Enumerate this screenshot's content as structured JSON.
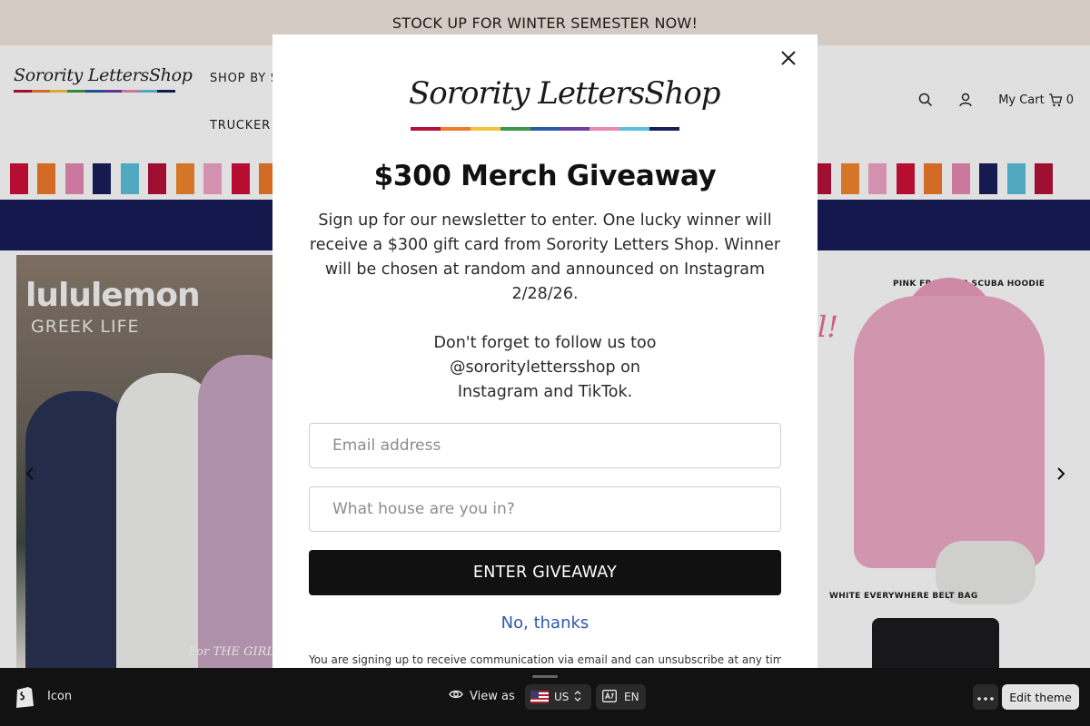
{
  "announcement": {
    "text": "STOCK UP FOR WINTER SEMESTER NOW!"
  },
  "header": {
    "logo_text": "Sorority LettersShop",
    "nav": [
      {
        "label": "SHOP BY SO"
      },
      {
        "label": "TRUCKER H"
      }
    ],
    "cart_label": "My Cart",
    "cart_count": "0",
    "search_icon": "search-icon",
    "account_icon": "user-icon",
    "cart_icon": "cart-icon"
  },
  "stripe_colors": [
    "#d0103a",
    "#f07a2a",
    "#e889b4",
    "#1a1f5a",
    "#5cc0dc",
    "#b5123a",
    "#f3862e",
    "#f2a6c8"
  ],
  "brand_colors": [
    "#b5123a",
    "#f07a2a",
    "#f2c53d",
    "#3a9a4a",
    "#2a5aa8",
    "#6b3fa0",
    "#e889b4",
    "#5cc0dc",
    "#1a1f5a"
  ],
  "hero": {
    "left_brand": "lululemon",
    "left_sub": "GREEK LIFE",
    "left_tag": "For THE GIRL",
    "right_label_top": "PINK FROSTING SCUBA HOODIE",
    "right_label_bottom": "WHITE EVERYWHERE BELT BAG",
    "right_script": "l!"
  },
  "modal": {
    "logo_text": "Sorority LettersShop",
    "title": "$300 Merch Giveaway",
    "description": "Sign up for our newsletter to enter. One lucky winner will receive a $300 gift card from Sorority Letters Shop. Winner will be chosen at random and announced on Instagram 2/28/26.",
    "follow_line1": "Don't forget to follow us too",
    "follow_line2": "@sororitylettersshop on",
    "follow_line3": "Instagram and TikTok.",
    "email_placeholder": "Email address",
    "house_placeholder": "What house are you in?",
    "submit_label": "ENTER GIVEAWAY",
    "dismiss_label": "No, thanks",
    "disclaimer": "You are signing up to receive communication via email and can unsubscribe at any time."
  },
  "bottombar": {
    "store_name": "Icon",
    "view_as": "View as",
    "country": "US",
    "language": "EN",
    "edit_label": "Edit theme"
  }
}
